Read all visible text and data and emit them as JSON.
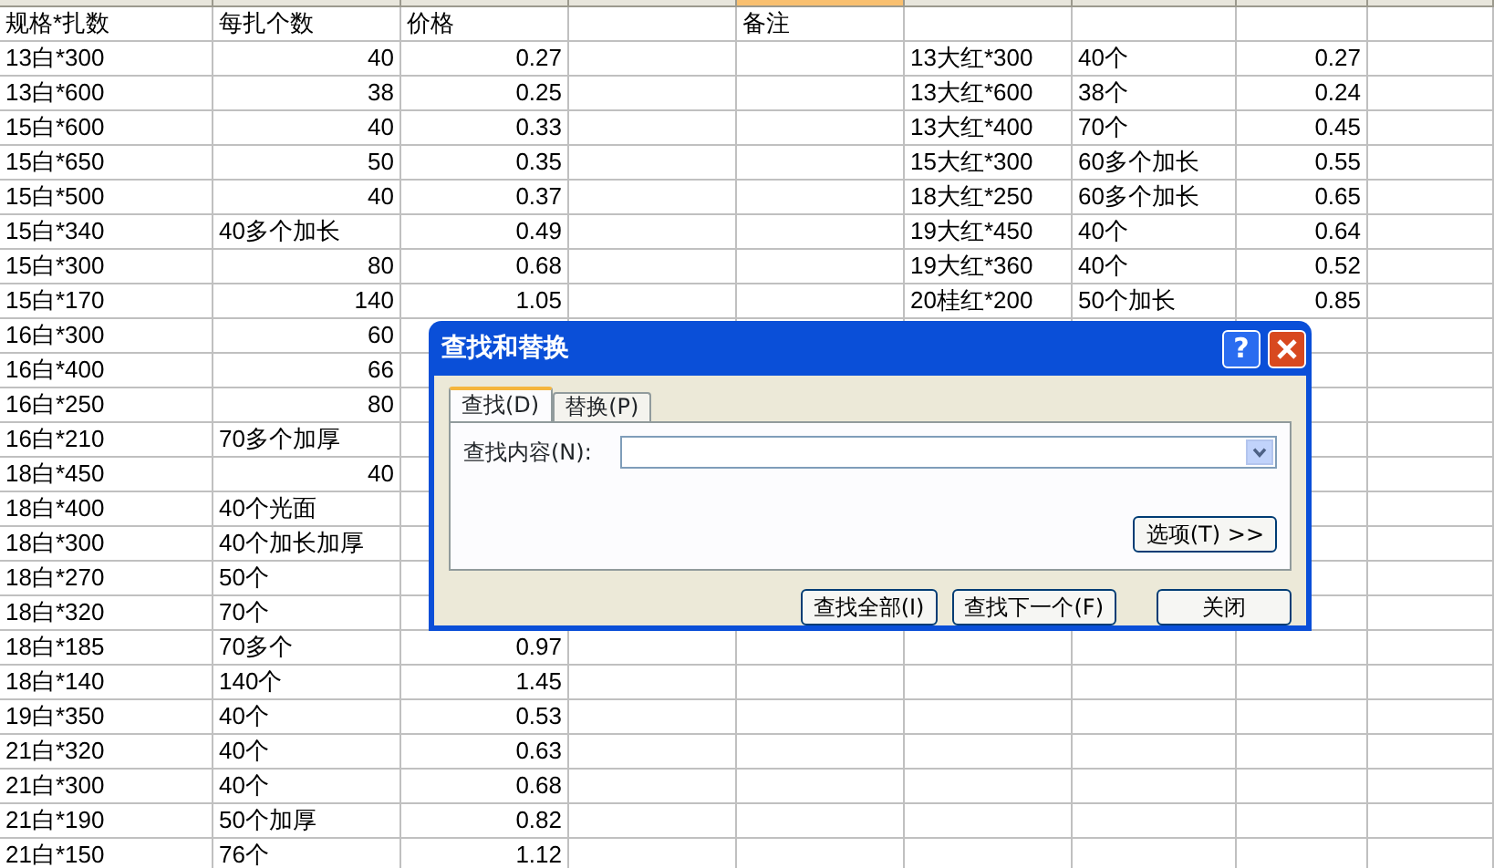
{
  "grid": {
    "column_header_selected": [
      false,
      false,
      false,
      false,
      true,
      false,
      false,
      false,
      false
    ]
  },
  "rows": [
    {
      "kind": "header",
      "spec": "规格*扎数",
      "count": "每扎个数",
      "price": "价格",
      "note": "备注"
    },
    {
      "kind": "data",
      "spec": "13白*300",
      "count": "40",
      "count_numeric": true,
      "price": "0.27",
      "extra_spec": "13大红*300",
      "extra_count": "40个",
      "extra_price": "0.27"
    },
    {
      "kind": "data",
      "spec": "13白*600",
      "count": "38",
      "count_numeric": true,
      "price": "0.25",
      "extra_spec": "13大红*600",
      "extra_count": "38个",
      "extra_price": "0.24"
    },
    {
      "kind": "data",
      "spec": "15白*600",
      "count": "40",
      "count_numeric": true,
      "price": "0.33",
      "extra_spec": "13大红*400",
      "extra_count": "70个",
      "extra_price": "0.45"
    },
    {
      "kind": "data",
      "spec": "15白*650",
      "count": "50",
      "count_numeric": true,
      "price": "0.35",
      "extra_spec": "15大红*300",
      "extra_count": "60多个加长",
      "extra_price": "0.55"
    },
    {
      "kind": "data",
      "spec": "15白*500",
      "count": "40",
      "count_numeric": true,
      "price": "0.37",
      "extra_spec": "18大红*250",
      "extra_count": "60多个加长",
      "extra_price": "0.65"
    },
    {
      "kind": "data",
      "spec": "15白*340",
      "count": "40多个加长",
      "count_numeric": false,
      "price": "0.49",
      "extra_spec": "19大红*450",
      "extra_count": "40个",
      "extra_price": "0.64"
    },
    {
      "kind": "data",
      "spec": "15白*300",
      "count": "80",
      "count_numeric": true,
      "price": "0.68",
      "extra_spec": "19大红*360",
      "extra_count": "40个",
      "extra_price": "0.52"
    },
    {
      "kind": "data",
      "spec": "15白*170",
      "count": "140",
      "count_numeric": true,
      "price": "1.05",
      "extra_spec": "20桂红*200",
      "extra_count": "50个加长",
      "extra_price": "0.85"
    },
    {
      "kind": "data",
      "spec": "16白*300",
      "count": "60",
      "count_numeric": true
    },
    {
      "kind": "data",
      "spec": "16白*400",
      "count": "66",
      "count_numeric": true
    },
    {
      "kind": "data",
      "spec": "16白*250",
      "count": "80",
      "count_numeric": true
    },
    {
      "kind": "data",
      "spec": "16白*210",
      "count": "70多个加厚",
      "count_numeric": false
    },
    {
      "kind": "data",
      "spec": "18白*450",
      "count": "40",
      "count_numeric": true
    },
    {
      "kind": "data",
      "spec": "18白*400",
      "count": "40个光面",
      "count_numeric": false
    },
    {
      "kind": "data",
      "spec": "18白*300",
      "count": "40个加长加厚",
      "count_numeric": false
    },
    {
      "kind": "data",
      "spec": "18白*270",
      "count": "50个",
      "count_numeric": false
    },
    {
      "kind": "data",
      "spec": "18白*320",
      "count": "70个",
      "count_numeric": false
    },
    {
      "kind": "data",
      "spec": "18白*185",
      "count": "70多个",
      "count_numeric": false,
      "price": "0.97"
    },
    {
      "kind": "data",
      "spec": "18白*140",
      "count": "140个",
      "count_numeric": false,
      "price": "1.45"
    },
    {
      "kind": "data",
      "spec": "19白*350",
      "count": "40个",
      "count_numeric": false,
      "price": "0.53"
    },
    {
      "kind": "data",
      "spec": "21白*320",
      "count": "40个",
      "count_numeric": false,
      "price": "0.63"
    },
    {
      "kind": "data",
      "spec": "21白*300",
      "count": "40个",
      "count_numeric": false,
      "price": "0.68"
    },
    {
      "kind": "data",
      "spec": "21白*190",
      "count": "50个加厚",
      "count_numeric": false,
      "price": "0.82"
    },
    {
      "kind": "data",
      "spec": "21白*150",
      "count": "76个",
      "count_numeric": false,
      "price": "1.12"
    }
  ],
  "dialog": {
    "title": "查找和替换",
    "help": "?",
    "tabs": [
      {
        "label": "查找(D)",
        "selected": true
      },
      {
        "label": "替换(P)",
        "selected": false
      }
    ],
    "find_label": "查找内容(N):",
    "options_button": "选项(T) >>",
    "buttons": [
      "查找全部(I)",
      "查找下一个(F)",
      "关闭"
    ]
  }
}
